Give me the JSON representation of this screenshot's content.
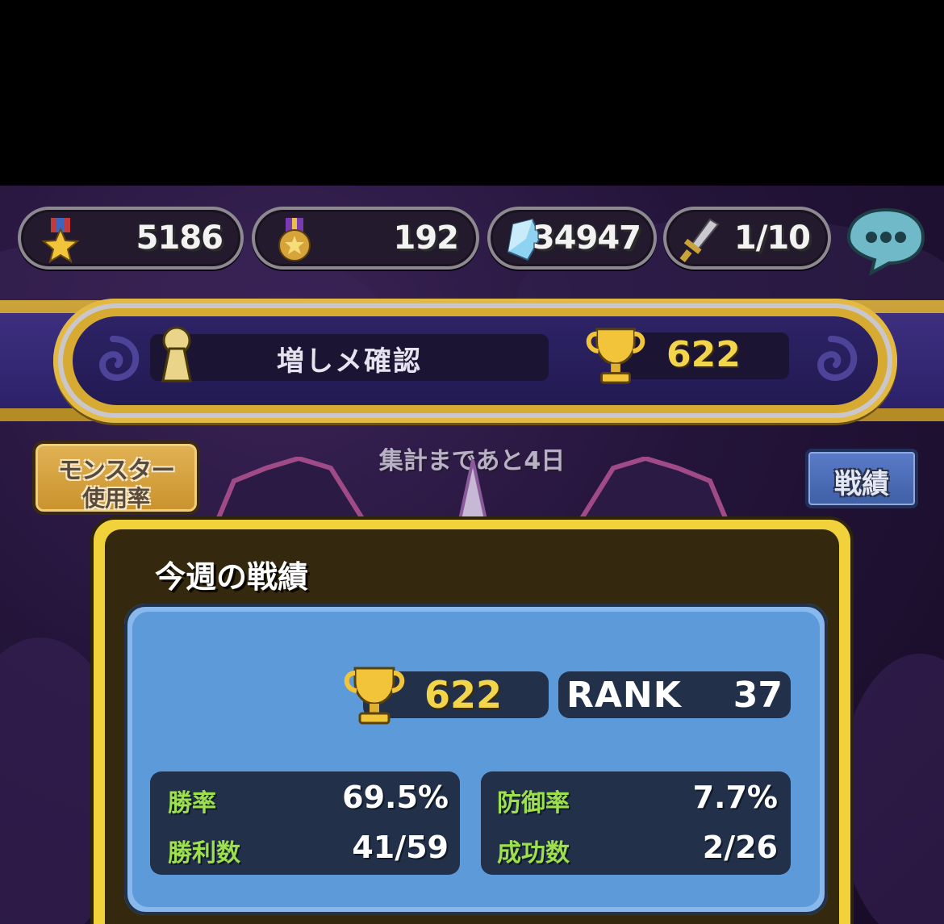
{
  "currencies": [
    {
      "icon": "star-medal-icon",
      "value": "5186"
    },
    {
      "icon": "gold-medal-icon",
      "value": "192"
    },
    {
      "icon": "crystal-icon",
      "value": "34947"
    },
    {
      "icon": "sword-icon",
      "value": "1/10"
    }
  ],
  "chat": {
    "icon": "chat-bubble-icon"
  },
  "banner": {
    "player_name": "増しメ確認",
    "trophies": "622"
  },
  "controls": {
    "monster_usage_line1": "モンスター",
    "monster_usage_line2": "使用率",
    "countdown": "集計まであと4日",
    "record_button": "戦績"
  },
  "weekly": {
    "title": "今週の戦績",
    "trophies": "622",
    "rank_label": "RANK",
    "rank_value": "37",
    "stats": [
      {
        "label": "勝率",
        "value": "69.5%"
      },
      {
        "label": "勝利数",
        "value": "41/59"
      },
      {
        "label": "防御率",
        "value": "7.7%"
      },
      {
        "label": "成功数",
        "value": "2/26"
      }
    ]
  },
  "colors": {
    "gold": "#f2d23a",
    "trophy_text": "#f2d54a",
    "stat_label": "#9ee04b",
    "card_blue": "#5c9ad9",
    "banner_purple": "#2d2366"
  }
}
